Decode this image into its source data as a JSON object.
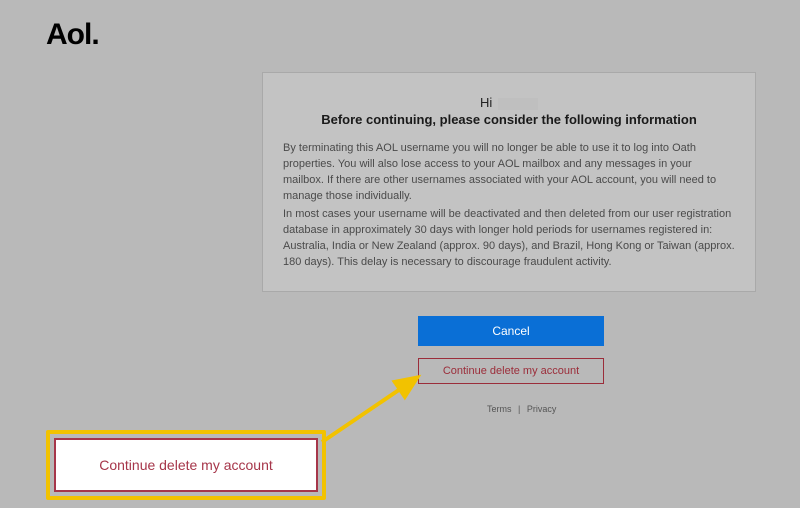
{
  "logo": "Aol.",
  "dialog": {
    "greeting_prefix": "Hi",
    "headline": "Before continuing, please consider the following information",
    "paragraph1": "By terminating this AOL username you will no longer be able to use it to log into Oath properties. You will also lose access to your AOL mailbox and any messages in your mailbox. If there are other usernames associated with your AOL account, you will need to manage those individually.",
    "paragraph2": "In most cases your username will be deactivated and then deleted from our user registration database in approximately 30 days with longer hold periods for usernames registered in: Australia, India or New Zealand (approx. 90 days), and Brazil, Hong Kong or Taiwan (approx. 180 days). This delay is necessary to discourage fraudulent activity."
  },
  "buttons": {
    "cancel": "Cancel",
    "continue": "Continue delete my account"
  },
  "footer": {
    "terms": "Terms",
    "sep": "|",
    "privacy": "Privacy"
  },
  "callout": {
    "label": "Continue delete my account"
  }
}
